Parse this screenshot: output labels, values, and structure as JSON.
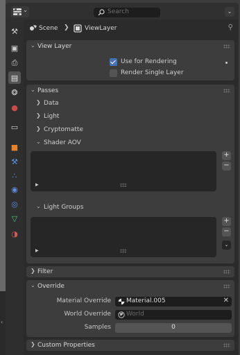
{
  "header": {
    "search_placeholder": "Search"
  },
  "tabs": [
    {
      "name": "tool-tab",
      "icon": "tool-icon",
      "glyph": "⚒",
      "color": "#cfcfcf"
    },
    {
      "name": "render-tab",
      "icon": "render-icon",
      "glyph": "▣",
      "color": "#cfcfcf"
    },
    {
      "name": "output-tab",
      "icon": "output-icon",
      "glyph": "⎙",
      "color": "#cfcfcf"
    },
    {
      "name": "view-layer-tab",
      "icon": "view-layer-icon",
      "glyph": "▤",
      "color": "#e6e6e6",
      "active": true
    },
    {
      "name": "scene-tab",
      "icon": "scene-icon",
      "glyph": "❂",
      "color": "#d9d9d9"
    },
    {
      "name": "world-tab",
      "icon": "world-icon",
      "glyph": "●",
      "color": "#c74b4b"
    },
    {
      "name": "collection-tab",
      "icon": "collection-icon",
      "glyph": "▭",
      "color": "#cfcfcf"
    },
    {
      "name": "object-tab",
      "icon": "object-icon",
      "glyph": "■",
      "color": "#e5822e"
    },
    {
      "name": "modifier-tab",
      "icon": "wrench-icon",
      "glyph": "⚒",
      "color": "#5e8ee0"
    },
    {
      "name": "particles-tab",
      "icon": "particles-icon",
      "glyph": "∴",
      "color": "#5e8ee0"
    },
    {
      "name": "physics-tab",
      "icon": "physics-icon",
      "glyph": "◉",
      "color": "#5e8ee0"
    },
    {
      "name": "constraints-tab",
      "icon": "constraints-icon",
      "glyph": "◎",
      "color": "#5e8ee0"
    },
    {
      "name": "data-tab",
      "icon": "mesh-data-icon",
      "glyph": "▽",
      "color": "#4fc37a"
    },
    {
      "name": "material-tab",
      "icon": "material-icon",
      "glyph": "◑",
      "color": "#d15a5a"
    }
  ],
  "breadcrumb": {
    "scene": "Scene",
    "view_layer": "ViewLayer"
  },
  "view_layer_panel": {
    "title": "View Layer",
    "use_for_rendering": {
      "label": "Use for Rendering",
      "checked": true
    },
    "render_single_layer": {
      "label": "Render Single Layer",
      "checked": false
    }
  },
  "passes_panel": {
    "title": "Passes",
    "subpanels": [
      "Data",
      "Light",
      "Cryptomatte"
    ],
    "shader_aov": "Shader AOV",
    "light_groups": "Light Groups"
  },
  "filter_panel": {
    "title": "Filter"
  },
  "override_panel": {
    "title": "Override",
    "material_override": {
      "label": "Material Override",
      "value": "Material.005"
    },
    "world_override": {
      "label": "World Override",
      "placeholder": "World"
    },
    "samples": {
      "label": "Samples",
      "value": "0"
    }
  },
  "custom_properties_panel": {
    "title": "Custom Properties"
  }
}
